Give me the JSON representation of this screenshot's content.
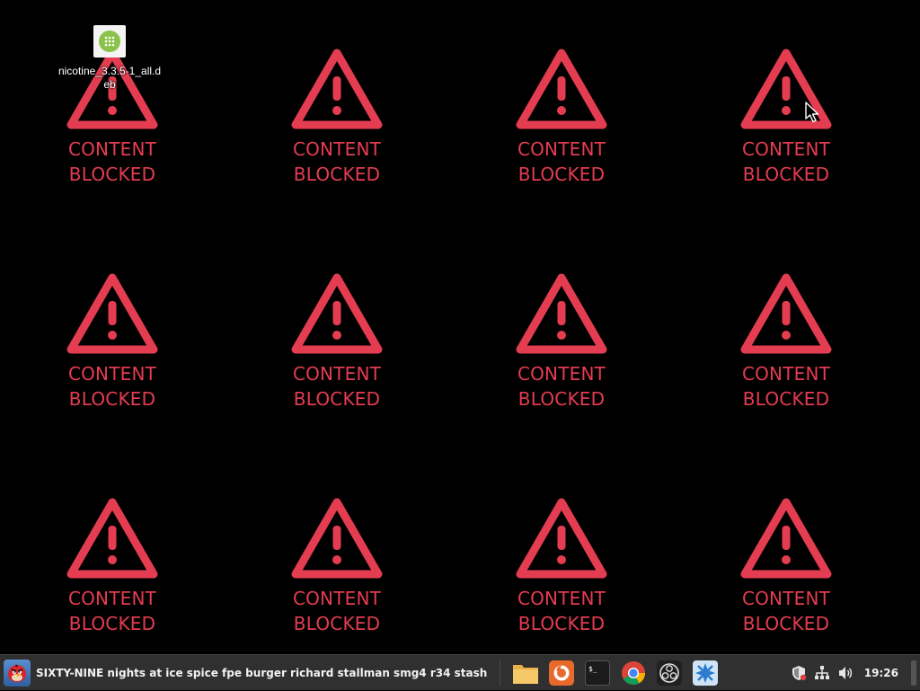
{
  "desktop": {
    "blocked_tiles": [
      {
        "line1": "CONTENT",
        "line2": "BLOCKED"
      },
      {
        "line1": "CONTENT",
        "line2": "BLOCKED"
      },
      {
        "line1": "CONTENT",
        "line2": "BLOCKED"
      },
      {
        "line1": "CONTENT",
        "line2": "BLOCKED"
      },
      {
        "line1": "CONTENT",
        "line2": "BLOCKED"
      },
      {
        "line1": "CONTENT",
        "line2": "BLOCKED"
      },
      {
        "line1": "CONTENT",
        "line2": "BLOCKED"
      },
      {
        "line1": "CONTENT",
        "line2": "BLOCKED"
      },
      {
        "line1": "CONTENT",
        "line2": "BLOCKED"
      },
      {
        "line1": "CONTENT",
        "line2": "BLOCKED"
      },
      {
        "line1": "CONTENT",
        "line2": "BLOCKED"
      },
      {
        "line1": "CONTENT",
        "line2": "BLOCKED"
      }
    ],
    "icons": [
      {
        "label": "nicotine_3.3.5-1_all.deb",
        "icon": "deb-package-icon"
      }
    ],
    "accent_color": "#e43c50"
  },
  "taskbar": {
    "active_window": {
      "title": "SIXTY-NINE nights at ice spice fpe burger richard stallman smg4 r34 stash",
      "icon": "angry-bird-icon"
    },
    "launchers": [
      {
        "name": "file-manager",
        "icon": "folder-icon"
      },
      {
        "name": "firefox",
        "icon": "firefox-icon"
      },
      {
        "name": "terminal",
        "icon": "terminal-icon"
      },
      {
        "name": "chrome",
        "icon": "chrome-icon"
      },
      {
        "name": "obs",
        "icon": "obs-icon"
      },
      {
        "name": "app",
        "icon": "blue-app-icon"
      }
    ],
    "tray": {
      "icons": [
        "shield-update-icon",
        "network-icon",
        "volume-icon"
      ],
      "clock": "19:26"
    }
  }
}
